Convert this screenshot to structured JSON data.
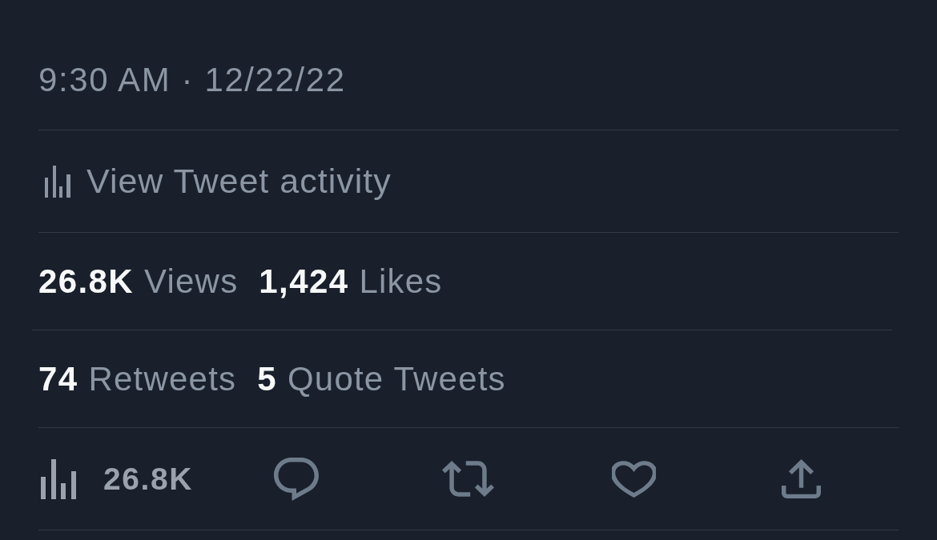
{
  "timestamp": {
    "text": "9:30 AM · 12/22/22"
  },
  "activity_link": {
    "label": "View Tweet activity"
  },
  "stats_rows": [
    {
      "stats": [
        {
          "count": "26.8K",
          "label": "Views"
        },
        {
          "count": "1,424",
          "label": "Likes"
        }
      ]
    },
    {
      "stats": [
        {
          "count": "74",
          "label": "Retweets"
        },
        {
          "count": "5",
          "label": "Quote Tweets"
        }
      ]
    }
  ],
  "action_bar": {
    "items": [
      {
        "kind": "views",
        "count": "26.8K"
      },
      {
        "kind": "reply"
      },
      {
        "kind": "retweet"
      },
      {
        "kind": "like"
      },
      {
        "kind": "share"
      }
    ]
  }
}
